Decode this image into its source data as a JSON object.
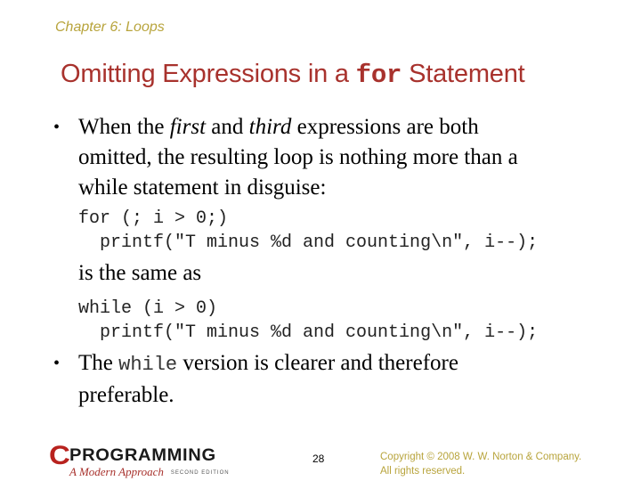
{
  "header": {
    "chapter_label": "Chapter 6: Loops"
  },
  "title": {
    "before_code": "Omitting Expressions in a ",
    "code": "for",
    "after_code": " Statement"
  },
  "colors": {
    "title": "#a8322d",
    "chapter_label": "#b8a43c",
    "copyright": "#b8a43c",
    "logo_c": "#b8221e"
  },
  "bullets": [
    {
      "icon": "bullet-dot",
      "glyph": "•",
      "line1_a": "When the ",
      "line1_em1": "first",
      "line1_b": " and ",
      "line1_em2": "third",
      "line1_c": " expressions are both",
      "line2": "omitted, the resulting loop is nothing more than a",
      "line3": "while statement in disguise:"
    },
    {
      "icon": "bullet-dot",
      "glyph": "•",
      "line1_a": "The ",
      "line1_code": "while",
      "line1_b": " version is clearer and therefore",
      "line2": "preferable."
    }
  ],
  "code_blocks": [
    {
      "lines": [
        "for (; i > 0;)",
        "  printf(\"T minus %d and counting\\n\", i--);"
      ]
    },
    {
      "lines": [
        "while (i > 0)",
        "  printf(\"T minus %d and counting\\n\", i--);"
      ]
    }
  ],
  "connector_text": "is the same as",
  "footer": {
    "logo": {
      "letter": "C",
      "word": "PROGRAMMING",
      "subtitle": "A Modern Approach",
      "edition": "SECOND EDITION"
    },
    "page_number": "28",
    "copyright_line1": "Copyright © 2008 W. W. Norton & Company.",
    "copyright_line2": "All rights reserved."
  }
}
